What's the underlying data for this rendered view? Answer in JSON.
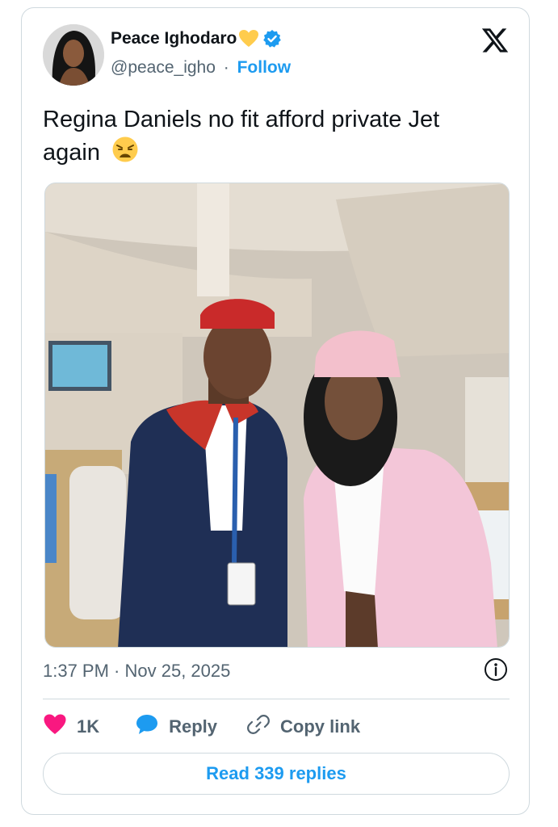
{
  "author": {
    "name": "Peace Ighodaro",
    "handle": "@peace_igho",
    "separator": "·",
    "follow_label": "Follow",
    "name_emoji": "yellow-heart-icon",
    "verified": true
  },
  "tweet": {
    "text": "Regina Daniels no fit afford private Jet again",
    "emoji": "weary-face-icon"
  },
  "meta": {
    "timestamp": "1:37 PM · Nov 25, 2025"
  },
  "actions": {
    "likes": "1K",
    "reply_label": "Reply",
    "copy_label": "Copy link"
  },
  "footer": {
    "read_replies_label": "Read 339 replies"
  },
  "colors": {
    "accent": "#1d9bf0",
    "like": "#f91880",
    "text": "#0f1419",
    "secondary": "#536471",
    "border": "#cfd9de"
  }
}
